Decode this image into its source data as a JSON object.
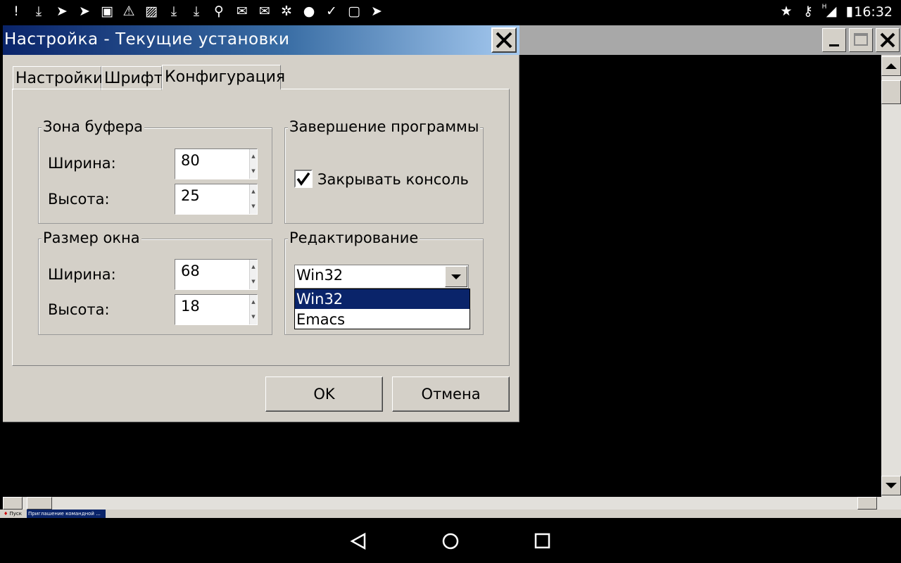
{
  "status_bar": {
    "time": "16:32",
    "icons": [
      "notification-alert-icon",
      "download-icon",
      "telegram-icon",
      "telegram-icon",
      "image-icon",
      "warning-icon",
      "gallery-icon",
      "download-icon",
      "download-icon",
      "search-icon",
      "mail-icon",
      "mail-icon",
      "settings-icon",
      "notification-icon",
      "check-icon",
      "app-icon",
      "telegram-icon"
    ],
    "right_icons": [
      "star-icon",
      "key-icon",
      "signal-icon",
      "battery-icon"
    ],
    "network_type": "H"
  },
  "dialog": {
    "title": "Настройка - Текущие установки",
    "tabs": [
      {
        "label": "Настройки"
      },
      {
        "label": "Шрифт"
      },
      {
        "label": "Конфигурация"
      }
    ],
    "active_tab": "Конфигурация",
    "buffer_group": {
      "title": "Зона буфера",
      "width_label": "Ширина:",
      "width_value": "80",
      "height_label": "Высота:",
      "height_value": "25"
    },
    "window_group": {
      "title": "Размер окна",
      "width_label": "Ширина:",
      "width_value": "68",
      "height_label": "Высота:",
      "height_value": "18"
    },
    "exit_group": {
      "title": "Завершение программы",
      "close_console_label": "Закрывать консоль",
      "close_console_checked": true
    },
    "editing_group": {
      "title": "Редактирование",
      "selected": "Win32",
      "options": [
        "Win32",
        "Emacs"
      ],
      "highlighted": "Win32"
    },
    "ok_label": "OK",
    "cancel_label": "Отмена"
  },
  "taskbar": {
    "start_label": "Пуск",
    "task_label": "Приглашение командной ..."
  },
  "colors": {
    "title_gradient_start": "#0a246a",
    "title_gradient_end": "#a6caf0",
    "dialog_bg": "#d4d0c8",
    "selection": "#0a246a"
  }
}
